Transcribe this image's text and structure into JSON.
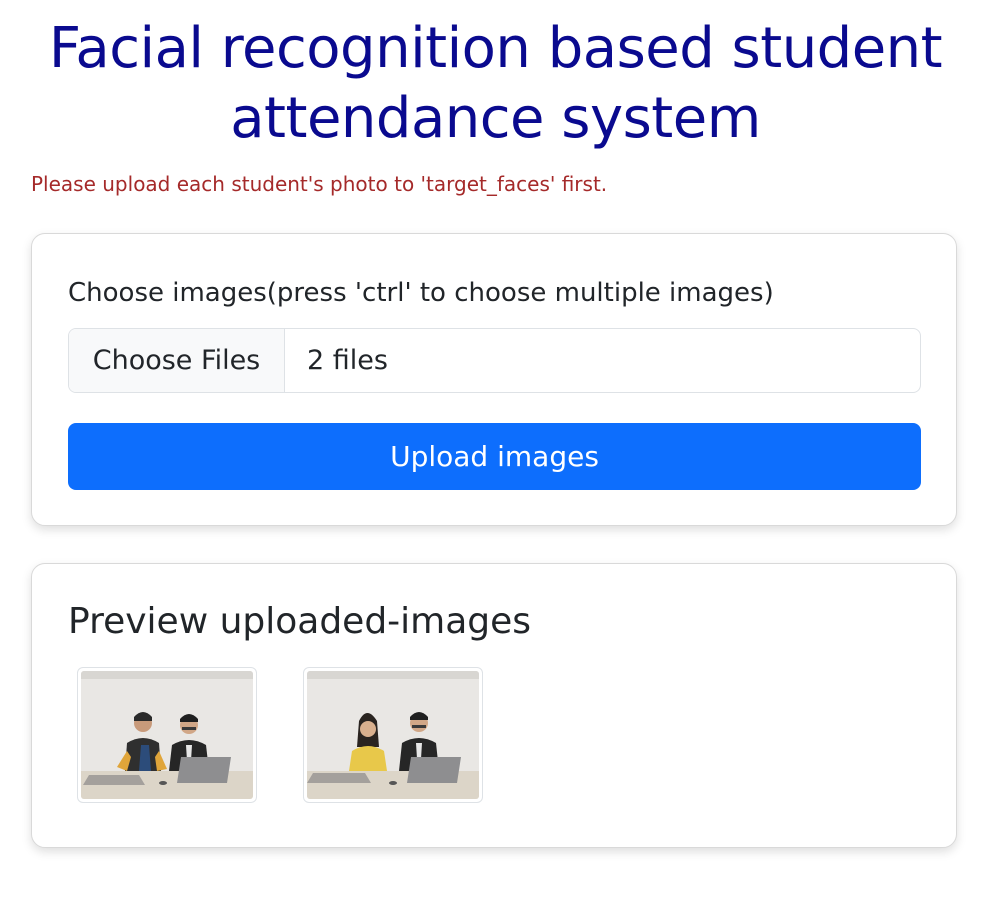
{
  "header": {
    "title": "Facial recognition based student attendance system",
    "notice": "Please upload each student's photo to 'target_faces' first."
  },
  "upload_form": {
    "label": "Choose images(press 'ctrl' to choose multiple images)",
    "file_button_label": "Choose Files",
    "file_status": "2 files",
    "submit_label": "Upload images"
  },
  "preview": {
    "title": "Preview uploaded-images",
    "images": [
      {
        "description_icon": "photo-two-students-with-laptops"
      },
      {
        "description_icon": "photo-two-students-with-laptops"
      }
    ]
  },
  "colors": {
    "title": "#0a0a8f",
    "notice": "#a52a2a",
    "primary_button": "#0d6efd"
  }
}
